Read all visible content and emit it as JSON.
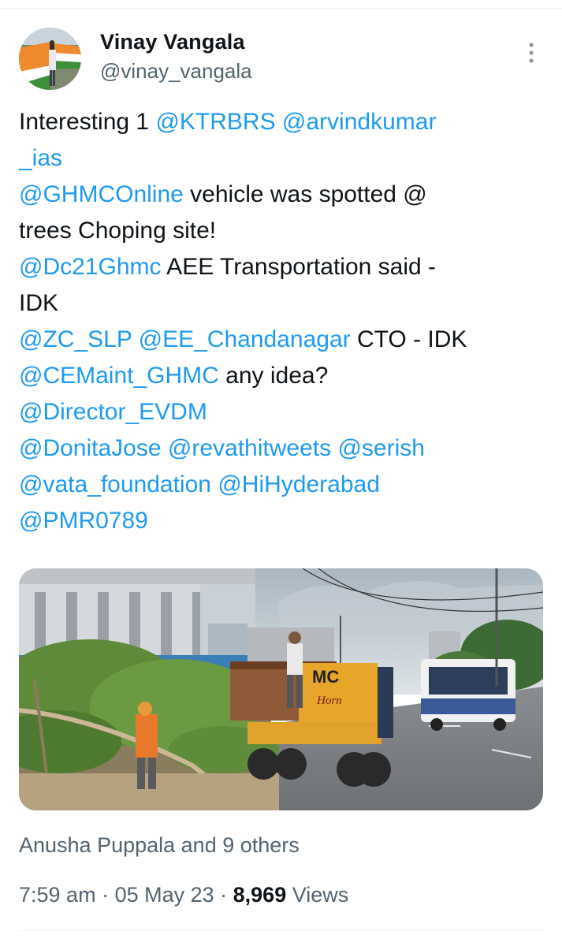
{
  "author": {
    "name": "Vinay Vangala",
    "handle": "@vinay_vangala"
  },
  "tweet": {
    "lines": [
      [
        {
          "t": "Interesting 1 ",
          "m": false
        },
        {
          "t": "@KTRBRS",
          "m": true
        },
        {
          "t": " ",
          "m": false
        },
        {
          "t": "@arvindkumar",
          "m": true
        }
      ],
      [
        {
          "t": "_ias",
          "m": true
        }
      ],
      [
        {
          "t": "@GHMCOnline",
          "m": true
        },
        {
          "t": " vehicle was spotted @",
          "m": false
        }
      ],
      [
        {
          "t": "trees Choping site!",
          "m": false
        }
      ],
      [
        {
          "t": "@Dc21Ghmc",
          "m": true
        },
        {
          "t": " AEE Transportation said -",
          "m": false
        }
      ],
      [
        {
          "t": "IDK",
          "m": false
        }
      ],
      [
        {
          "t": "@ZC_SLP",
          "m": true
        },
        {
          "t": " ",
          "m": false
        },
        {
          "t": "@EE_Chandanagar",
          "m": true
        },
        {
          "t": " CTO - IDK",
          "m": false
        }
      ],
      [
        {
          "t": "@CEMaint_GHMC",
          "m": true
        },
        {
          "t": " any idea?",
          "m": false
        }
      ],
      [
        {
          "t": "@Director_EVDM",
          "m": true
        }
      ],
      [
        {
          "t": "@DonitaJose",
          "m": true
        },
        {
          "t": " ",
          "m": false
        },
        {
          "t": "@revathitweets",
          "m": true
        },
        {
          "t": " ",
          "m": false
        },
        {
          "t": "@serish",
          "m": true
        }
      ],
      [
        {
          "t": "@vata_foundation",
          "m": true
        },
        {
          "t": " ",
          "m": false
        },
        {
          "t": "@HiHyderabad",
          "m": true
        }
      ],
      [
        {
          "t": "@PMR0789",
          "m": true
        }
      ]
    ]
  },
  "media": {
    "truck_text_line1": "MC",
    "truck_text_line2": "Horn"
  },
  "social": {
    "liked_by": "Anusha Puppala and 9 others"
  },
  "meta": {
    "time": "7:59 am",
    "separator": " · ",
    "date": "05 May 23",
    "views_count": "8,969",
    "views_label": " Views"
  },
  "colors": {
    "mention": "#1d9bf0",
    "text": "#0f1419",
    "secondary": "#536471"
  },
  "icons": {
    "more": "more-vertical-icon"
  }
}
